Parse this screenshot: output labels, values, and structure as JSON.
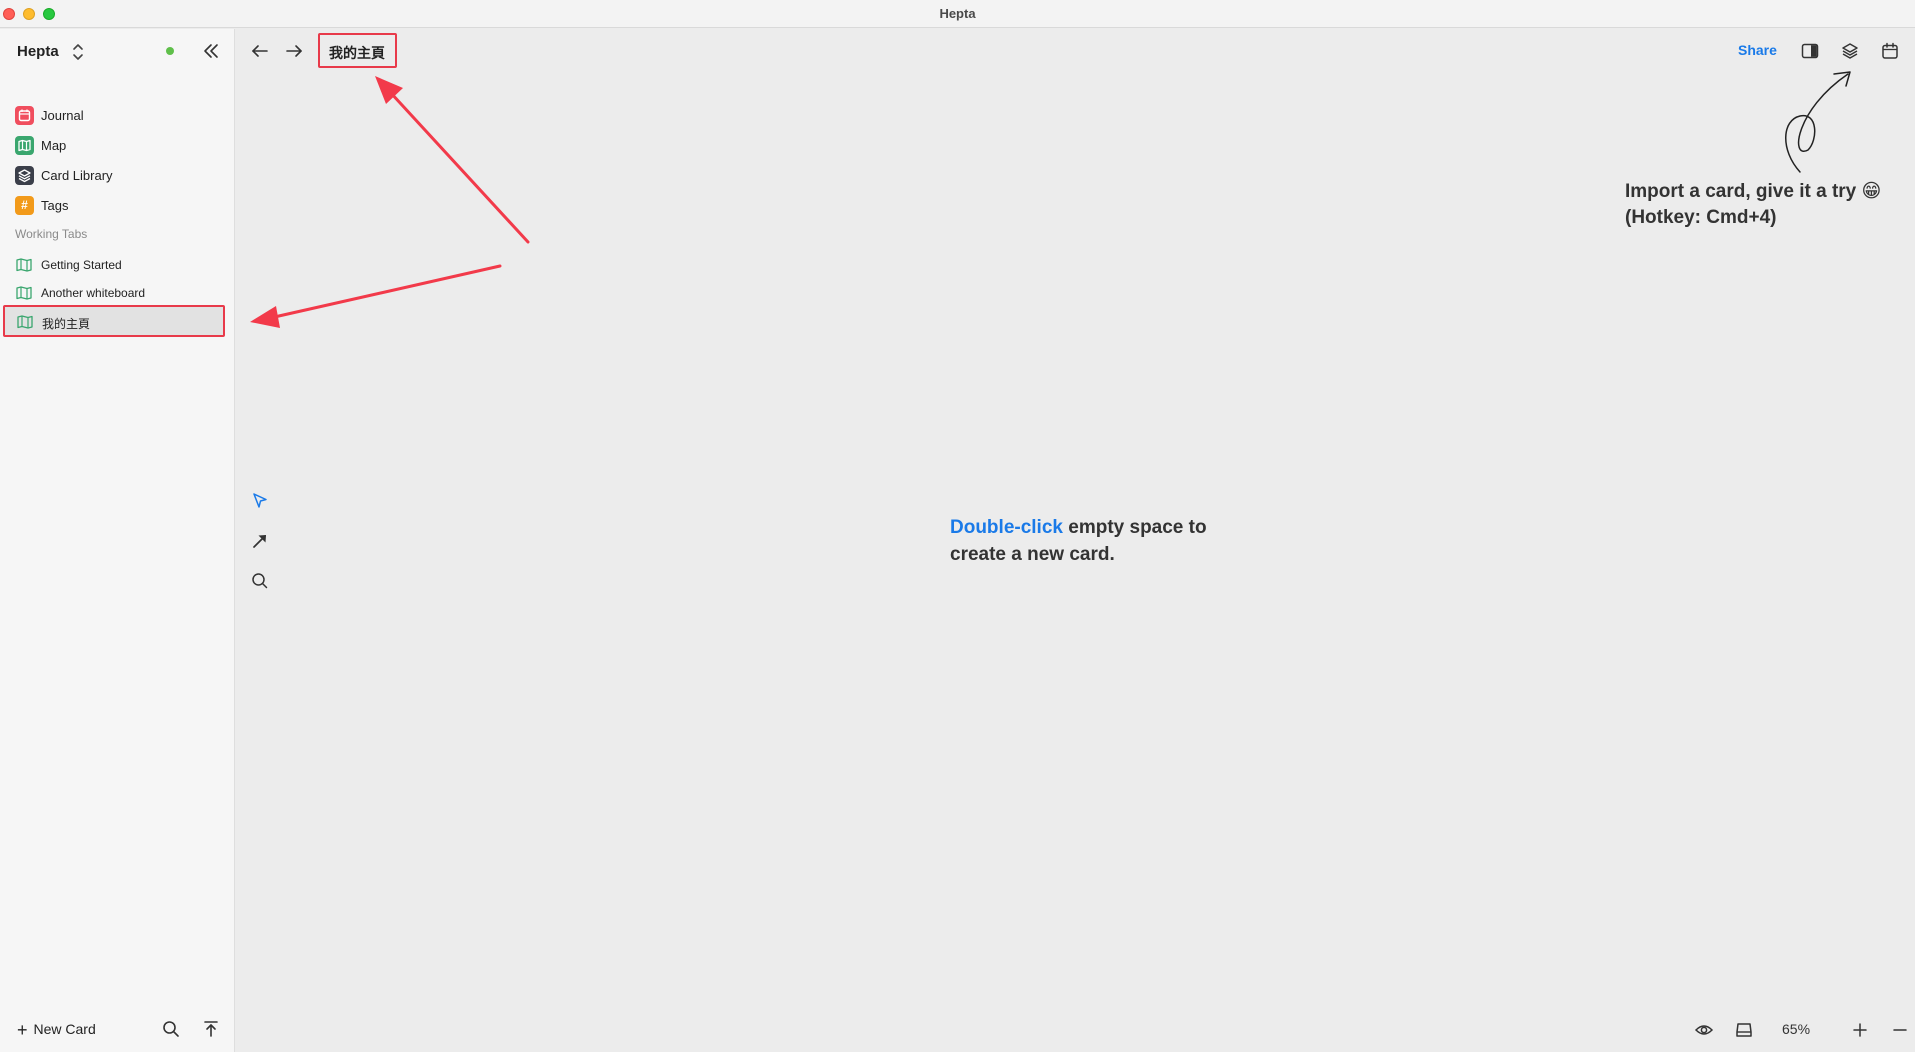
{
  "window": {
    "title": "Hepta"
  },
  "sidebar": {
    "workspace_name": "Hepta",
    "nav_items": [
      {
        "label": "Journal",
        "icon": "calendar-icon",
        "color": "#f04e5e"
      },
      {
        "label": "Map",
        "icon": "map-icon",
        "color": "#3aa66e"
      },
      {
        "label": "Card Library",
        "icon": "layers-icon",
        "color": "#3b3f4a"
      },
      {
        "label": "Tags",
        "icon": "hash-icon",
        "color": "#f29a1a"
      }
    ],
    "section_label": "Working Tabs",
    "tabs": [
      {
        "label": "Getting Started",
        "icon": "map-icon"
      },
      {
        "label": "Another whiteboard",
        "icon": "map-icon"
      },
      {
        "label": "我的主頁",
        "icon": "map-icon",
        "active": true
      }
    ],
    "new_card_label": "New Card",
    "status_color": "#5fbf4a"
  },
  "toolbar": {
    "page_title": "我的主頁",
    "share_label": "Share"
  },
  "canvas": {
    "tip_text": "Import a card, give it a try 😁 (Hotkey: Cmd+4)",
    "hint_accent": "Double-click",
    "hint_rest": " empty space to create a new card."
  },
  "footer": {
    "zoom_level": "65%"
  },
  "colors": {
    "accent": "#1a7ae8",
    "highlight": "#e83a4a"
  }
}
